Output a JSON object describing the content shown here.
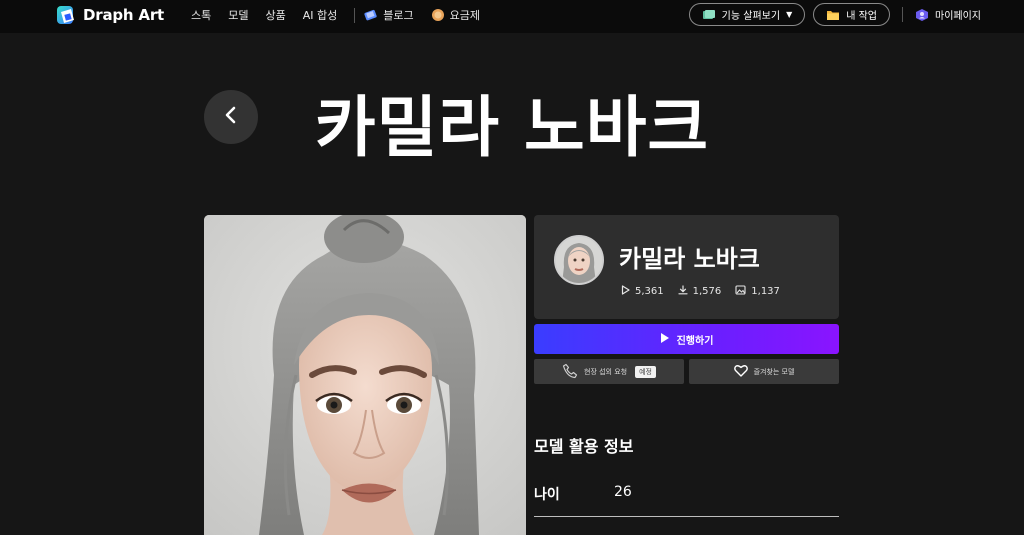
{
  "nav": {
    "brand": "Draph Art",
    "links": [
      "스톡",
      "모델",
      "상품",
      "AI 합성"
    ],
    "blog": "블로그",
    "pricing": "요금제",
    "explore": "기능 살펴보기",
    "my_work": "내 작업",
    "my_page": "마이페이지"
  },
  "page": {
    "title": "카밀라 노바크"
  },
  "model": {
    "name": "카밀라 노바크",
    "views": "5,361",
    "downloads": "1,576",
    "images": "1,137"
  },
  "actions": {
    "proceed": "진행하기",
    "onsite_request": "현장 섭외 요청",
    "onsite_badge": "예정",
    "favorite": "즐겨찾는 모델"
  },
  "info": {
    "section_title": "모델 활용 정보",
    "rows": [
      {
        "label": "나이",
        "value": "26"
      }
    ]
  },
  "icons": {
    "back": "chevron-left-icon",
    "play": "play-icon",
    "download": "download-icon",
    "image": "image-icon",
    "phone": "phone-icon",
    "heart": "heart-icon"
  },
  "colors": {
    "background": "#161616",
    "nav": "#0b0b0b",
    "card": "#2e2e2e",
    "accent_start": "#3a3dff",
    "accent_end": "#8a14ff"
  }
}
